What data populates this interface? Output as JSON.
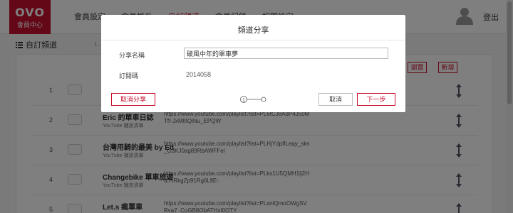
{
  "header": {
    "logo_mark": "OVO",
    "logo_sub": "會員中心",
    "nav": [
      "會員設定",
      "會員帳戶",
      "自訂頻道",
      "會員紀錄",
      "相關設定"
    ],
    "active_index": 2,
    "logout": "登出"
  },
  "subheader": {
    "title": "自訂頻道",
    "tiny_note": "1 ..."
  },
  "panel_buttons": {
    "browse": "瀏覽",
    "add": "新增"
  },
  "rows": [
    {
      "num": "1",
      "title": "",
      "type": "",
      "url": ""
    },
    {
      "num": "2",
      "title": "Eric 的單車日誌",
      "type": "YouTube 播放清單",
      "url": "https://www.youtube.com/playlist?list=PL6tCJ8AdP4J50MTfI-JxMIlIQiNu_EPQW"
    },
    {
      "num": "3",
      "title": "台灣用騎的最美 by Ed",
      "type": "YouTube 播放清單",
      "url": "https://www.youtube.com/playlist?list=PLHjYdpfILeqy_sks_G3KJ0ag89RbAWFFel"
    },
    {
      "num": "4",
      "title": "Changebike 單車旅遊",
      "type": "YouTube 播放清單",
      "url": "https://www.youtube.com/playlist?list=PLks1U5QMH1lj2HtL7tRkgZp91Rg6LflE-"
    },
    {
      "num": "5",
      "title": "Let.s 瘋單車",
      "type": "",
      "url": "https://www.youtube.com/playlist?list=PLsnlQmoOWgSVRva7_CoGB8ObATHxI0OTY"
    }
  ],
  "modal": {
    "title": "頻道分享",
    "share_name_label": "分享名稱",
    "share_name_value": "破風中年的單車夢",
    "code_label": "訂閱碼",
    "code_value": "2014058",
    "cancel_share": "取消分享",
    "step_current": "1",
    "cancel": "取消",
    "next": "下一步"
  },
  "colors": {
    "brand": "#c8102e",
    "overlay": "rgba(0,0,0,0.5)"
  }
}
